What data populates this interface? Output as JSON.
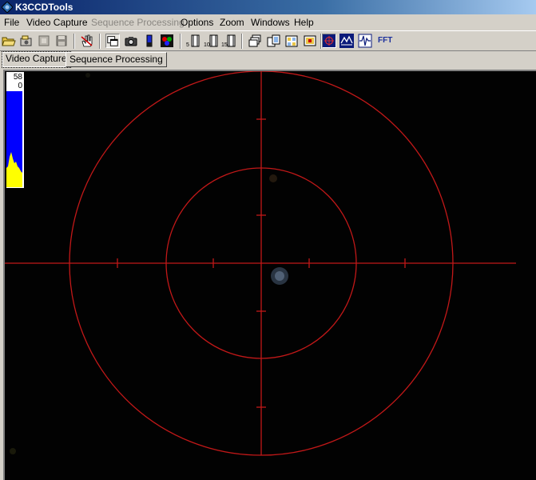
{
  "window": {
    "title": "K3CCDTools"
  },
  "menu": {
    "items": [
      {
        "label": "File",
        "enabled": true
      },
      {
        "label": "Video Capture",
        "enabled": true
      },
      {
        "label": "Sequence Processing",
        "enabled": false
      },
      {
        "label": "Options",
        "enabled": true
      },
      {
        "label": "Zoom",
        "enabled": true
      },
      {
        "label": "Windows",
        "enabled": true
      },
      {
        "label": "Help",
        "enabled": true
      }
    ]
  },
  "toolbar": {
    "buttons": [
      "open-folder-icon",
      "capture-icon",
      "film-icon",
      "save-icon",
      "hand-tool-icon",
      "window-icon",
      "camera-icon",
      "brightness-icon",
      "rgb-icon",
      "frames-5-icon",
      "frames-10-icon",
      "frames-15-icon",
      "multi-window-icon",
      "film-strip-icon",
      "film-stack-icon",
      "film-select-icon",
      "crosshair-icon",
      "histogram-icon",
      "waveform-icon"
    ],
    "fft_label": "FFT",
    "frames": [
      "5",
      "10",
      "15"
    ],
    "active": "crosshair-icon"
  },
  "tabs": [
    {
      "label": "Video Capture",
      "selected": true
    },
    {
      "label": "Sequence Processing",
      "selected": false
    }
  ],
  "histogram": {
    "max": "58",
    "min": "0"
  },
  "colors": {
    "reticle": "#c21818",
    "histo_blue": "#0000ff",
    "histo_yellow": "#ffff00",
    "viewport_bg": "#020202"
  }
}
